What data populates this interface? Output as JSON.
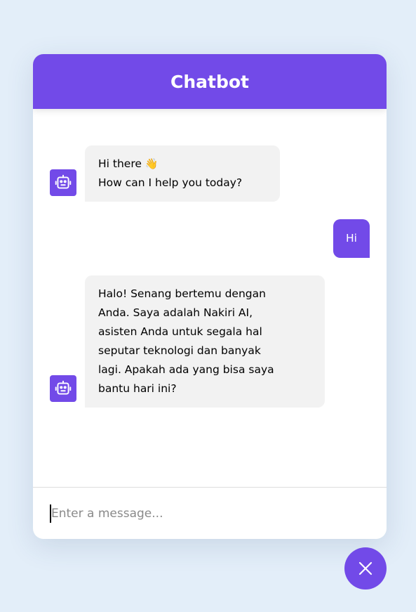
{
  "header": {
    "title": "Chatbot"
  },
  "messages": [
    {
      "role": "incoming",
      "avatar_icon": "robot-icon",
      "line1": "Hi there",
      "emoji": "👋",
      "line2": "How can I help you today?"
    },
    {
      "role": "outgoing",
      "text": "Hi"
    },
    {
      "role": "incoming",
      "avatar_icon": "robot-icon",
      "text": "Halo! Senang bertemu dengan\nAnda. Saya adalah Nakiri AI,\nasisten Anda untuk segala hal\nseputar teknologi dan banyak\nlagi. Apakah ada yang bisa saya\nbantu hari ini?"
    }
  ],
  "input": {
    "placeholder": "Enter a message...",
    "value": ""
  },
  "toggler": {
    "icon": "close-icon"
  },
  "colors": {
    "accent": "#724ae8",
    "background": "#e3eef9",
    "incoming_bubble": "#f2f2f2"
  }
}
